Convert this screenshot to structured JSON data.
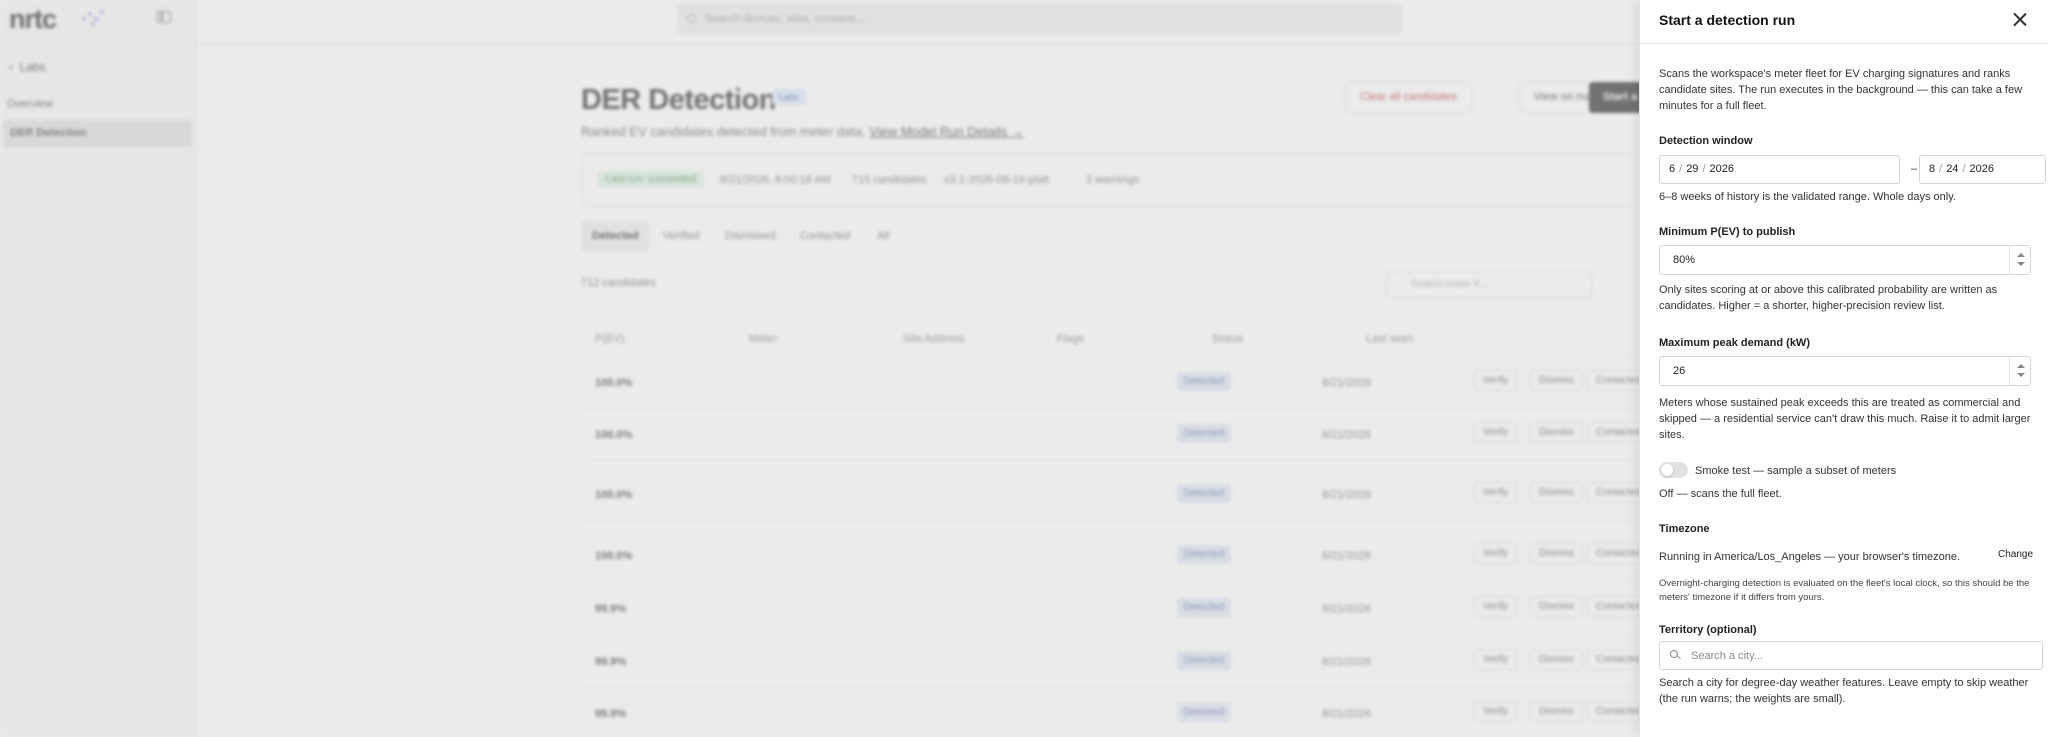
{
  "app": {
    "logo": "nrtc",
    "search_placeholder": "Search devices, sites, contacts...",
    "sidebar": {
      "back_label": "Labs",
      "items": [
        {
          "label": "Overview"
        },
        {
          "label": "DER Detection"
        }
      ]
    },
    "page": {
      "title": "DER Detection",
      "badge": "Labs",
      "subtitle": "Ranked EV candidates detected from meter data.",
      "subtitle_link": "View Model Run Details →",
      "buttons": {
        "clear": "Clear all candidates",
        "map": "View on map",
        "start": "Start a"
      },
      "status": {
        "pill": "Last run: succeeded",
        "time": "8/21/2026, 8:00:18 AM",
        "candidates": "715 candidates",
        "version": "v3.1-2026-08-19-platt",
        "warnings": "2 warnings"
      },
      "tabs": [
        "Detected",
        "Verified",
        "Dismissed",
        "Contacted",
        "All"
      ],
      "candidate_count": "712 candidates",
      "meter_search_placeholder": "Search meter #...",
      "columns": [
        "P(EV)",
        "Meter",
        "Site Address",
        "Flags",
        "Status",
        "Last seen"
      ],
      "rows": [
        {
          "pev": "100.0%",
          "status": "Detected",
          "last_seen": "8/21/2026"
        },
        {
          "pev": "100.0%",
          "status": "Detected",
          "last_seen": "8/21/2026"
        },
        {
          "pev": "100.0%",
          "status": "Detected",
          "last_seen": "8/21/2026"
        },
        {
          "pev": "100.0%",
          "status": "Detected",
          "last_seen": "8/21/2026"
        },
        {
          "pev": "99.9%",
          "status": "Detected",
          "last_seen": "8/21/2026"
        },
        {
          "pev": "99.9%",
          "status": "Detected",
          "last_seen": "8/21/2026"
        },
        {
          "pev": "99.9%",
          "status": "Detected",
          "last_seen": "8/21/2026"
        }
      ],
      "row_actions": [
        "Verify",
        "Dismiss",
        "Contacted"
      ]
    }
  },
  "drawer": {
    "title": "Start a detection run",
    "intro": "Scans the workspace's meter fleet for EV charging signatures and ranks candidate sites. The run executes in the background — this can take a few minutes for a full fleet.",
    "window": {
      "label": "Detection window",
      "start": {
        "month": "6",
        "day": "29",
        "year": "2026"
      },
      "end": {
        "month": "8",
        "day": "24",
        "year": "2026"
      },
      "dash": "–",
      "help": "6–8 weeks of history is the validated range. Whole days only."
    },
    "min_pev": {
      "label": "Minimum P(EV) to publish",
      "value": "80%",
      "help": "Only sites scoring at or above this calibrated probability are written as candidates. Higher = a shorter, higher-precision review list."
    },
    "max_peak": {
      "label": "Maximum peak demand (kW)",
      "value": "26",
      "help": "Meters whose sustained peak exceeds this are treated as commercial and skipped — a residential service can't draw this much. Raise it to admit larger sites."
    },
    "smoke": {
      "label": "Smoke test — sample a subset of meters",
      "enabled": false,
      "state_text": "Off — scans the full fleet."
    },
    "timezone": {
      "label": "Timezone",
      "text": "Running in America/Los_Angeles — your browser's timezone.",
      "change": "Change",
      "help": "Overnight-charging detection is evaluated on the fleet's local clock, so this should be the meters' timezone if it differs from yours."
    },
    "territory": {
      "label": "Territory (optional)",
      "placeholder": "Search a city...",
      "help": "Search a city for degree-day weather features. Leave empty to skip weather (the run warns; the weights are small)."
    }
  }
}
